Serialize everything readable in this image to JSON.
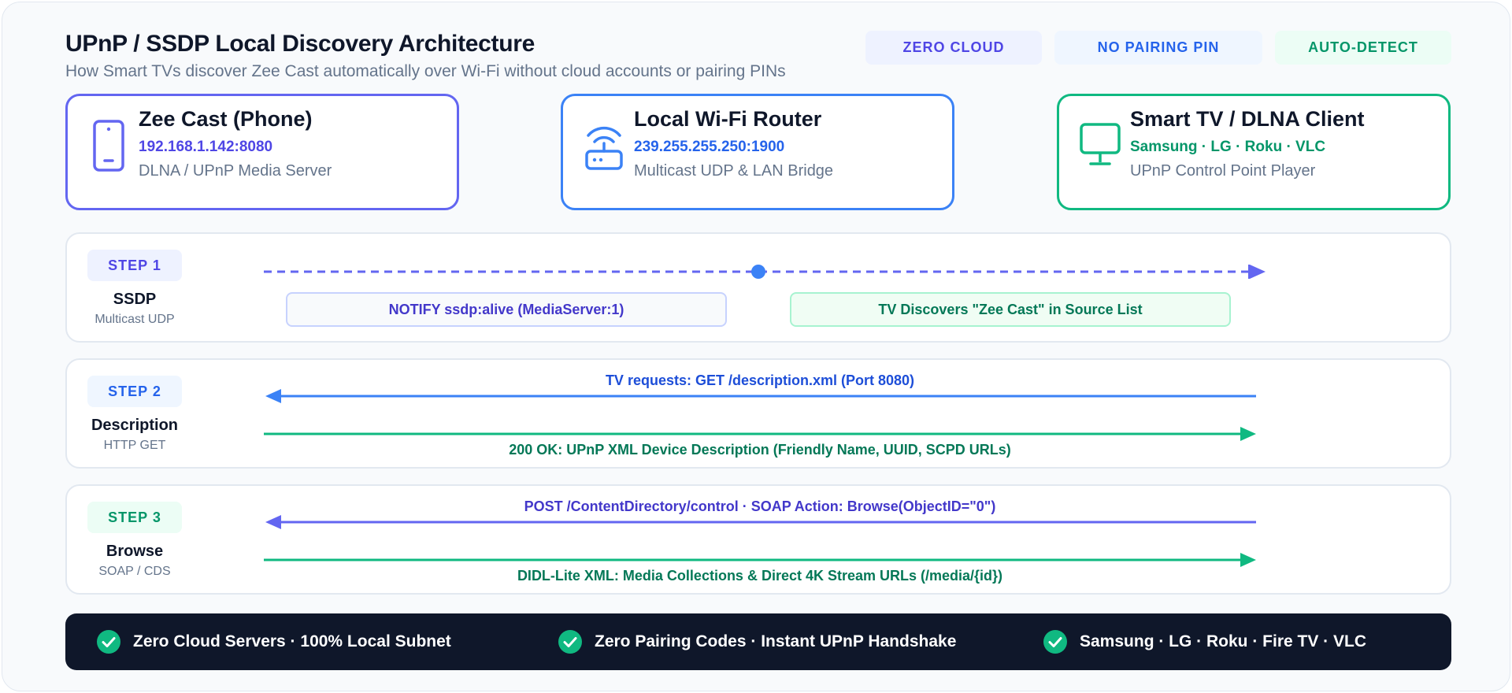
{
  "header": {
    "title": "UPnP / SSDP Local Discovery Architecture",
    "subtitle": "How Smart TVs discover Zee Cast automatically over Wi-Fi without cloud accounts or pairing PINs",
    "tags": [
      "ZERO CLOUD",
      "NO PAIRING PIN",
      "AUTO-DETECT"
    ]
  },
  "nodes": {
    "phone": {
      "name": "Zee Cast (Phone)",
      "address": "192.168.1.142:8080",
      "role": "DLNA / UPnP Media Server",
      "icon": "smartphone-icon"
    },
    "router": {
      "name": "Local Wi-Fi Router",
      "address": "239.255.255.250:1900",
      "role": "Multicast UDP & LAN Bridge",
      "icon": "router-icon"
    },
    "tv": {
      "name": "Smart TV / DLNA Client",
      "address": "Samsung · LG · Roku · VLC",
      "role": "UPnP Control Point Player",
      "icon": "monitor-icon"
    }
  },
  "steps": [
    {
      "badge": "STEP 1",
      "name": "SSDP",
      "protocol": "Multicast UDP",
      "flows": [
        "NOTIFY ssdp:alive (MediaServer:1)",
        "TV Discovers \"Zee Cast\" in Source List"
      ]
    },
    {
      "badge": "STEP 2",
      "name": "Description",
      "protocol": "HTTP GET",
      "request": "TV requests: GET /description.xml (Port 8080)",
      "response": "200 OK: UPnP XML Device Description (Friendly Name, UUID, SCPD URLs)"
    },
    {
      "badge": "STEP 3",
      "name": "Browse",
      "protocol": "SOAP / CDS",
      "request": "POST /ContentDirectory/control · SOAP Action: Browse(ObjectID=\"0\")",
      "response": "DIDL-Lite XML: Media Collections & Direct 4K Stream URLs (/media/{id})"
    }
  ],
  "footer": [
    "Zero Cloud Servers · 100% Local Subnet",
    "Zero Pairing Codes · Instant UPnP Handshake",
    "Samsung · LG · Roku · Fire TV · VLC"
  ],
  "colors": {
    "indigo": "#6366f1",
    "blue": "#3b82f6",
    "green": "#10b981",
    "dark": "#0f172a"
  }
}
